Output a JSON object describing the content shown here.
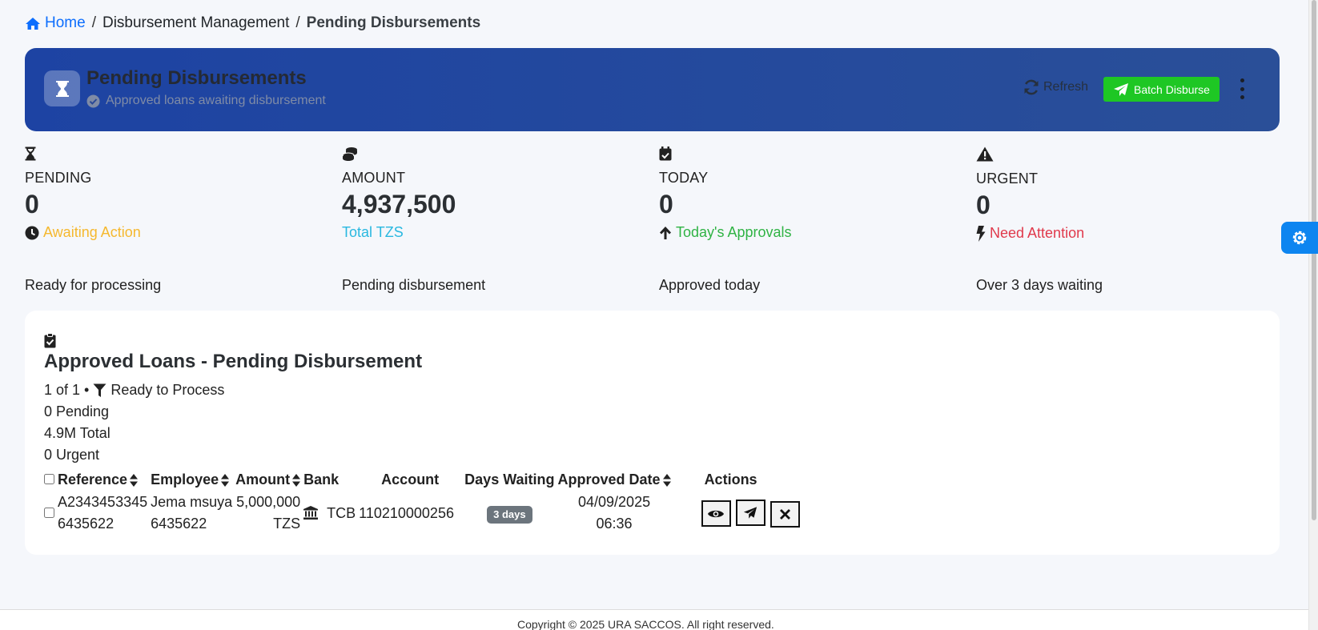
{
  "breadcrumb": {
    "home": "Home",
    "section": "Disbursement Management",
    "current": "Pending Disbursements"
  },
  "hero": {
    "title": "Pending Disbursements",
    "subtitle": "Approved loans awaiting disbursement",
    "refresh_label": "Refresh",
    "batch_label": "Batch Disburse"
  },
  "stats": [
    {
      "label": "PENDING",
      "value": "0",
      "note": "Awaiting Action",
      "desc": "Ready for processing",
      "color": "#f5b82e",
      "icon": "hourglass-icon"
    },
    {
      "label": "AMOUNT",
      "value": "4,937,500",
      "note": "Total TZS",
      "desc": "Pending disbursement",
      "color": "#29b8e0",
      "icon": "coins-icon"
    },
    {
      "label": "TODAY",
      "value": "0",
      "note": "Today's Approvals",
      "desc": "Approved today",
      "color": "#2fb344",
      "icon": "calendar-check-icon"
    },
    {
      "label": "URGENT",
      "value": "0",
      "note": "Need Attention",
      "desc": "Over 3 days waiting",
      "color": "#e0394b",
      "icon": "warning-icon"
    }
  ],
  "card": {
    "title": "Approved Loans - Pending Disbursement",
    "count_text": "1 of 1 •",
    "filter_text": "Ready to Process",
    "pending_text": "0 Pending",
    "total_text": "4.9M Total",
    "urgent_text": "0 Urgent"
  },
  "table": {
    "headers": {
      "reference": "Reference",
      "employee": "Employee",
      "amount": "Amount",
      "bank": "Bank",
      "account": "Account",
      "days": "Days Waiting",
      "approved": "Approved Date",
      "actions": "Actions"
    },
    "rows": [
      {
        "reference_1": "A2343453345",
        "reference_2": "6435622",
        "employee_1": "Jema msuya",
        "employee_2": "6435622",
        "amount_1": "5,000,000",
        "amount_2": "TZS",
        "bank": "TCB",
        "account": "110210000256",
        "days": "3 days",
        "date_1": "04/09/2025",
        "date_2": "06:36"
      }
    ]
  },
  "footer": {
    "text": "Copyright © 2025 URA SACCOS. All right reserved."
  }
}
